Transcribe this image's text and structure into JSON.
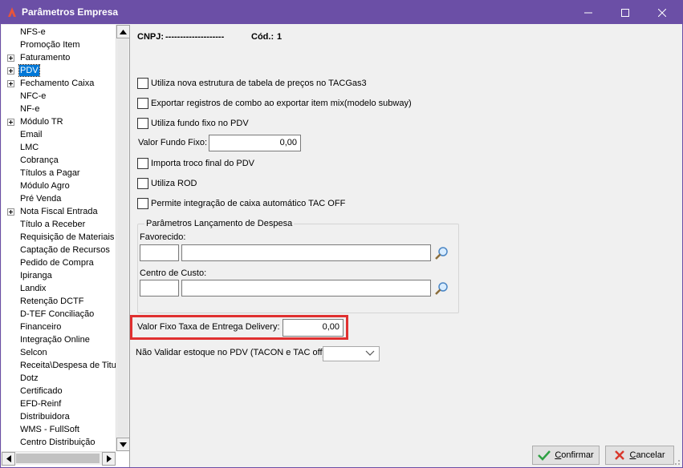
{
  "window": {
    "title": "Parâmetros Empresa"
  },
  "tree": {
    "items": [
      {
        "label": "NFS-e",
        "expandable": false,
        "selected": false
      },
      {
        "label": "Promoção Item",
        "expandable": false,
        "selected": false
      },
      {
        "label": "Faturamento",
        "expandable": true,
        "selected": false
      },
      {
        "label": "PDV",
        "expandable": true,
        "selected": true
      },
      {
        "label": "Fechamento Caixa",
        "expandable": true,
        "selected": false
      },
      {
        "label": "NFC-e",
        "expandable": false,
        "selected": false
      },
      {
        "label": "NF-e",
        "expandable": false,
        "selected": false
      },
      {
        "label": "Módulo TR",
        "expandable": true,
        "selected": false
      },
      {
        "label": "Email",
        "expandable": false,
        "selected": false
      },
      {
        "label": "LMC",
        "expandable": false,
        "selected": false
      },
      {
        "label": "Cobrança",
        "expandable": false,
        "selected": false
      },
      {
        "label": "Títulos a Pagar",
        "expandable": false,
        "selected": false
      },
      {
        "label": "Módulo Agro",
        "expandable": false,
        "selected": false
      },
      {
        "label": "Pré Venda",
        "expandable": false,
        "selected": false
      },
      {
        "label": "Nota Fiscal Entrada",
        "expandable": true,
        "selected": false
      },
      {
        "label": "Título a Receber",
        "expandable": false,
        "selected": false
      },
      {
        "label": "Requisição de Materiais",
        "expandable": false,
        "selected": false
      },
      {
        "label": "Captação de Recursos",
        "expandable": false,
        "selected": false
      },
      {
        "label": "Pedido de Compra",
        "expandable": false,
        "selected": false
      },
      {
        "label": "Ipiranga",
        "expandable": false,
        "selected": false
      },
      {
        "label": "Landix",
        "expandable": false,
        "selected": false
      },
      {
        "label": "Retenção DCTF",
        "expandable": false,
        "selected": false
      },
      {
        "label": "D-TEF Conciliação",
        "expandable": false,
        "selected": false
      },
      {
        "label": "Financeiro",
        "expandable": false,
        "selected": false
      },
      {
        "label": "Integração Online",
        "expandable": false,
        "selected": false
      },
      {
        "label": "Selcon",
        "expandable": false,
        "selected": false
      },
      {
        "label": "Receita\\Despesa de Titul",
        "expandable": false,
        "selected": false
      },
      {
        "label": "Dotz",
        "expandable": false,
        "selected": false
      },
      {
        "label": "Certificado",
        "expandable": false,
        "selected": false
      },
      {
        "label": "EFD-Reinf",
        "expandable": false,
        "selected": false
      },
      {
        "label": "Distribuidora",
        "expandable": false,
        "selected": false
      },
      {
        "label": "WMS - FullSoft",
        "expandable": false,
        "selected": false
      },
      {
        "label": "Centro Distribuição",
        "expandable": false,
        "selected": false
      }
    ]
  },
  "header": {
    "cnpj_label": "CNPJ:",
    "cnpj_value": "--------------------",
    "cod_label": "Cód.:",
    "cod_value": "1"
  },
  "options": {
    "nova_estrutura": "Utiliza nova estrutura de tabela de preços no TACGas3",
    "exportar_combo": "Exportar registros de combo ao exportar item mix(modelo subway)",
    "fundo_fixo": "Utiliza fundo fixo no PDV",
    "valor_fundo_fixo_label": "Valor Fundo Fixo:",
    "valor_fundo_fixo_value": "0,00",
    "importa_troco": "Importa troco final do PDV",
    "utiliza_rod": "Utiliza ROD",
    "integracao_caixa": "Permite integração de caixa automático TAC OFF"
  },
  "despesa": {
    "title": "Parâmetros Lançamento de Despesa",
    "favorecido_label": "Favorecido:",
    "centro_custo_label": "Centro de Custo:"
  },
  "delivery": {
    "label": "Valor Fixo Taxa de Entrega Delivery:",
    "value": "0,00"
  },
  "estoque": {
    "label": "Não Validar estoque no PDV (TACON e TAC off):",
    "selected": ""
  },
  "footer": {
    "confirm_label": "Confirmar",
    "cancel_label": "Cancelar"
  },
  "colors": {
    "titlebar": "#6b4fa6",
    "selection": "#0078d7",
    "highlight": "#e03030"
  }
}
